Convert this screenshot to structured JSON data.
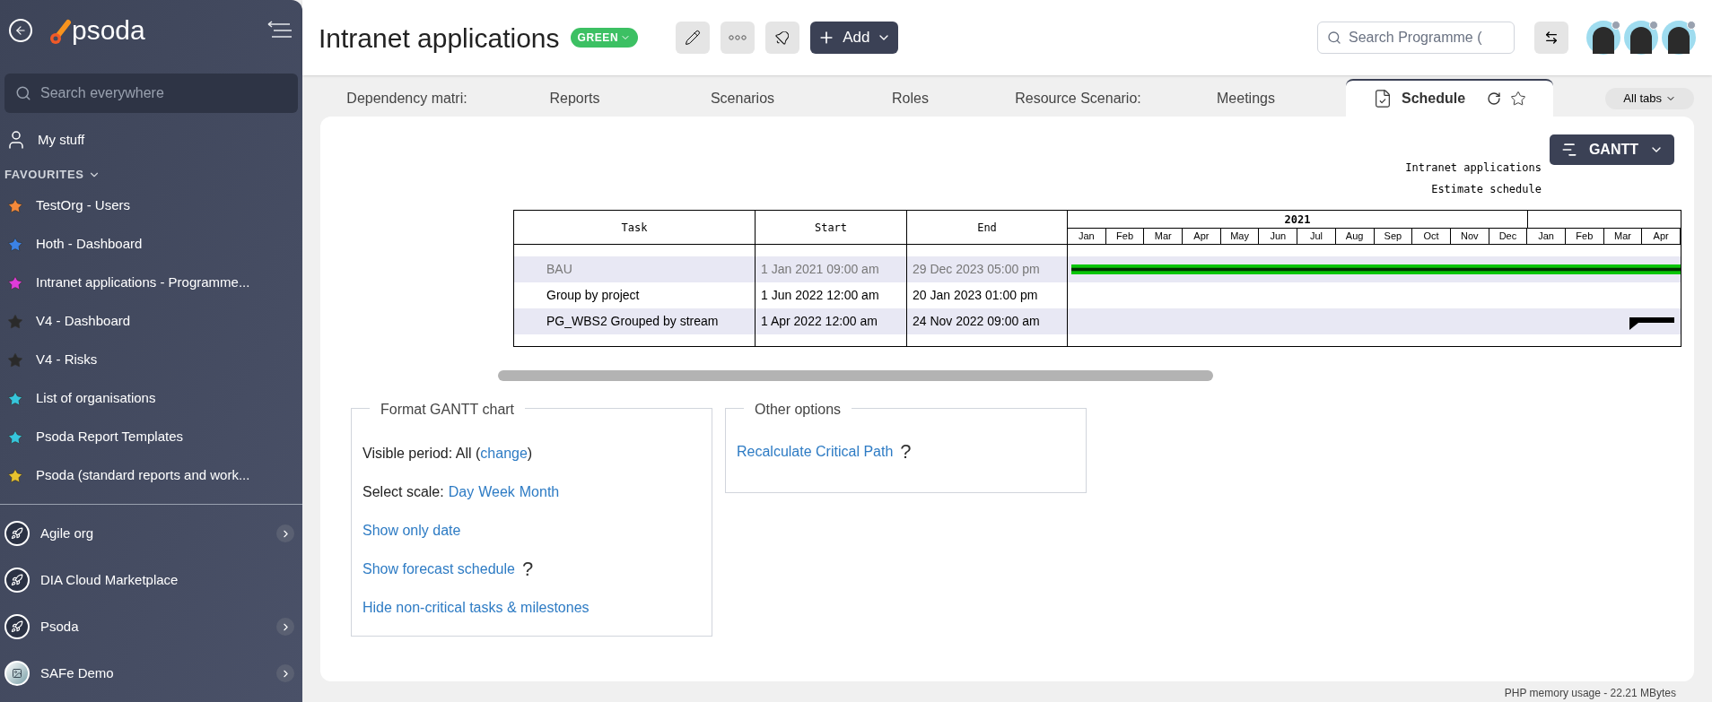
{
  "sidebar": {
    "logo": "psoda",
    "search": {
      "placeholder": "Search everywhere"
    },
    "my_stuff": "My stuff",
    "favourites_heading": "FAVOURITES",
    "favourites": [
      {
        "label": "TestOrg - Users",
        "color": "#f5893a"
      },
      {
        "label": "Hoth - Dashboard",
        "color": "#3b82e6"
      },
      {
        "label": "Intranet applications - Programme...",
        "color": "#e03bd8"
      },
      {
        "label": "V4 - Dashboard",
        "color": "#2a2a2a"
      },
      {
        "label": "V4 - Risks",
        "color": "#2a2a2a"
      },
      {
        "label": "List of organisations",
        "color": "#36c6dc"
      },
      {
        "label": "Psoda Report Templates",
        "color": "#36c6dc"
      },
      {
        "label": "Psoda (standard reports and work...",
        "color": "#e8c22e"
      }
    ],
    "workspaces": [
      {
        "label": "Agile org",
        "kind": "rocket",
        "expandable": true
      },
      {
        "label": "DIA Cloud Marketplace",
        "kind": "rocket",
        "expandable": false
      },
      {
        "label": "Psoda",
        "kind": "rocket",
        "expandable": true
      },
      {
        "label": "SAFe Demo",
        "kind": "image",
        "expandable": true
      }
    ]
  },
  "header": {
    "title": "Intranet applications",
    "status": {
      "label": "GREEN",
      "color": "#3cc063"
    },
    "add_button": "Add",
    "search": {
      "placeholder": "Search Programme ("
    },
    "avatars": [
      {
        "online": false
      },
      {
        "online": false
      },
      {
        "online": false
      }
    ]
  },
  "tabs": [
    {
      "label": "Dependency matri:",
      "selected": false
    },
    {
      "label": "Reports",
      "selected": false
    },
    {
      "label": "Scenarios",
      "selected": false
    },
    {
      "label": "Roles",
      "selected": false
    },
    {
      "label": "Resource Scenario:",
      "selected": false
    },
    {
      "label": "Meetings",
      "selected": false
    },
    {
      "label": "Schedule",
      "selected": true
    }
  ],
  "all_tabs": "All tabs",
  "view_button": "GANTT",
  "gantt": {
    "titles": [
      "Intranet applications",
      "Estimate schedule"
    ],
    "columns": [
      "Task",
      "Start",
      "End"
    ],
    "years": [
      "2021"
    ],
    "months": [
      "Jan",
      "Feb",
      "Mar",
      "Apr",
      "May",
      "Jun",
      "Jul",
      "Aug",
      "Sep",
      "Oct",
      "Nov",
      "Dec",
      "Jan",
      "Feb",
      "Mar",
      "Apr"
    ],
    "rows": [
      {
        "task": "BAU",
        "start": "1 Jan 2021 09:00 am",
        "end": "29 Dec 2023 05:00 pm",
        "kind": "task",
        "muted": true
      },
      {
        "task": "Group by project",
        "start": "1 Jun 2022 12:00 am",
        "end": "20 Jan 2023 01:00 pm",
        "kind": "none",
        "muted": false
      },
      {
        "task": "PG_WBS2 Grouped by stream",
        "start": "1 Apr 2022 12:00 am",
        "end": "24 Nov 2022 09:00 am",
        "kind": "summary",
        "muted": false
      }
    ]
  },
  "format_panel": {
    "title": "Format GANTT chart",
    "visible_period_label": "Visible period: All (",
    "visible_period_link": "change",
    "visible_period_end": ")",
    "scale_label": "Select scale:",
    "scales": [
      "Day",
      "Week",
      "Month"
    ],
    "links": [
      {
        "label": "Show only date"
      },
      {
        "label": "Show forecast schedule",
        "help": "?"
      },
      {
        "label": "Hide non-critical tasks & milestones"
      }
    ]
  },
  "other_panel": {
    "title": "Other options",
    "links": [
      {
        "label": "Recalculate Critical Path",
        "help": "?"
      }
    ]
  },
  "footer": "PHP memory usage - 22.21 MBytes"
}
